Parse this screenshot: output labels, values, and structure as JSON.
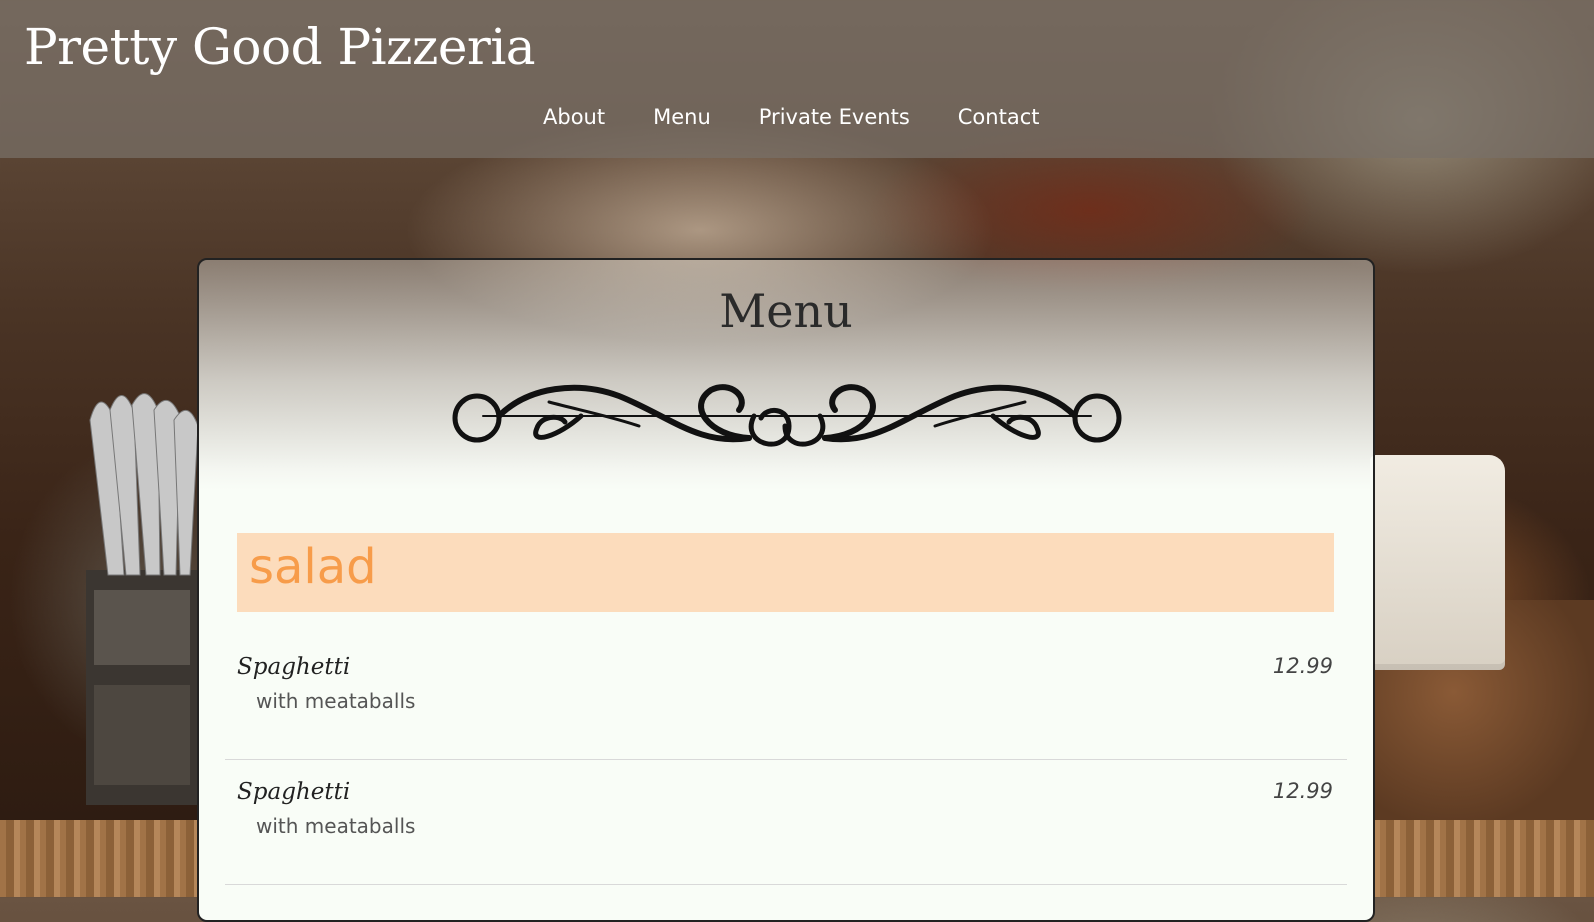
{
  "site": {
    "title": "Pretty Good Pizzeria"
  },
  "nav": {
    "items": [
      {
        "label": "About"
      },
      {
        "label": "Menu"
      },
      {
        "label": "Private Events"
      },
      {
        "label": "Contact"
      }
    ]
  },
  "menu": {
    "title": "Menu",
    "ornament_icon": "flourish-divider-icon",
    "sections": [
      {
        "title": "salad",
        "accent_color": "#f79c4a",
        "background_color": "#fcdcbc",
        "items": [
          {
            "name": "Spaghetti",
            "description": "with meataballs",
            "price": "12.99"
          },
          {
            "name": "Spaghetti",
            "description": "with meataballs",
            "price": "12.99"
          }
        ]
      }
    ]
  }
}
